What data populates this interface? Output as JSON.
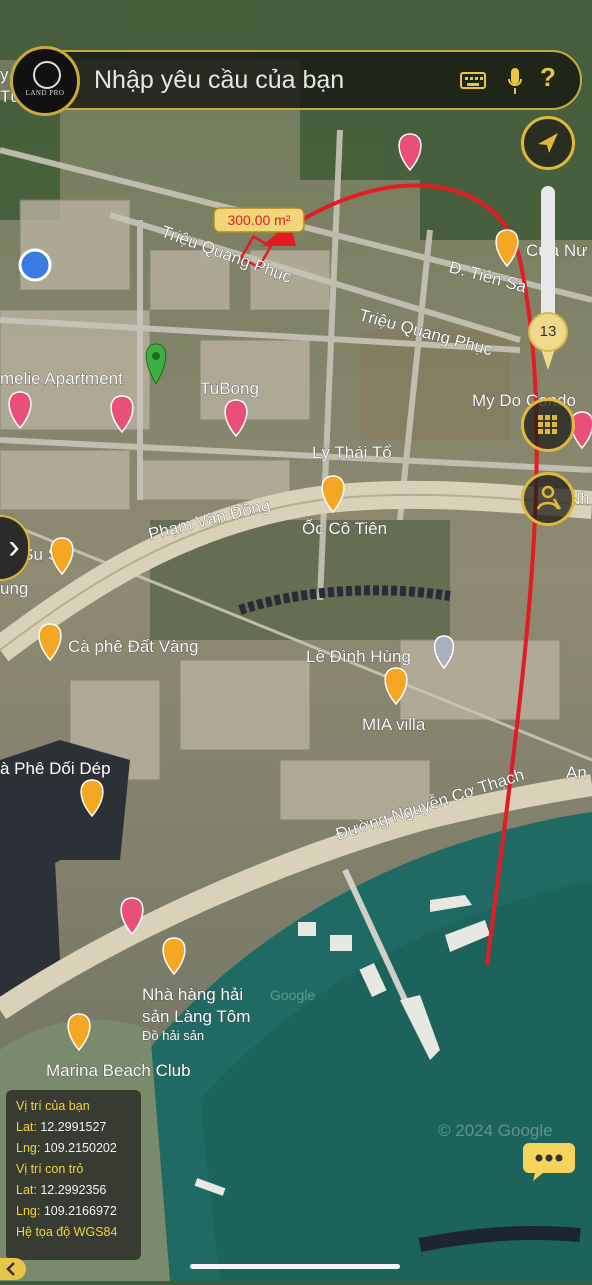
{
  "search": {
    "placeholder": "Nhập yêu cầu của bạn",
    "logo_text": "LAND PRO"
  },
  "zoom": {
    "level": "13"
  },
  "parcel": {
    "area_label": "300.00 m²"
  },
  "map_labels": {
    "street_1": "Triệu Quang Phục",
    "street_2": "Triệu Quang Phục",
    "street_3": "Đ. Tiên Sa",
    "street_4": "Lý Thái Tổ",
    "street_5": "Phạm Văn Đồng",
    "street_6": "Đường Nguyễn Cơ Thạch",
    "poi_1": "melie Apartment",
    "poi_2": "TuBong",
    "poi_3": "My Do Condo",
    "poi_4": "Cửa Nư",
    "poi_5": "Ốc Cô Tiên",
    "poi_6": "u Su Su",
    "poi_7": "ung",
    "poi_8": "Cà phê Đất Vàng",
    "poi_9": "Lê Đình Hùng",
    "poi_10": "MIA villa",
    "poi_11": "à Phê Dối Dép",
    "poi_12": "An",
    "poi_13": "Nhà hàng hải",
    "poi_14": "sản Làng Tôm",
    "poi_15": "Đồ hải sản",
    "poi_16": "Marina Beach Club",
    "poi_17": "Nh",
    "poi_18": "y",
    "poi_19": "Tư",
    "watermark": "© 2024 Google",
    "watermark_2": "Google"
  },
  "info_panel": {
    "your_position_label": "Vị trí của bạn",
    "lat1_label": "Lat:",
    "lat1_value": "12.2991527",
    "lng1_label": "Lng:",
    "lng1_value": "109.2150202",
    "pointer_label": "Vị trí con trỏ",
    "lat2_label": "Lat:",
    "lat2_value": "12.2992356",
    "lng2_label": "Lng:",
    "lng2_value": "109.2166972",
    "crs_label": "Hệ tọa độ WGS84"
  },
  "icons": [
    "globe-logo-icon",
    "keyboard-icon",
    "microphone-icon",
    "help-icon",
    "navigation-arrow-icon",
    "grid-layers-icon",
    "street-view-person-icon",
    "chevron-right-icon",
    "chat-bubble-icon",
    "back-arrow-icon",
    "location-pin-icon",
    "hotel-pin-icon",
    "restaurant-pin-icon",
    "cafe-pin-icon"
  ],
  "colors": {
    "accent_gold": "#e0b93b",
    "route_red": "#e31b23",
    "sea": "#1f6b63",
    "pin_green": "#3cb043",
    "pin_pink": "#e8507a",
    "pin_orange": "#f5a623"
  }
}
